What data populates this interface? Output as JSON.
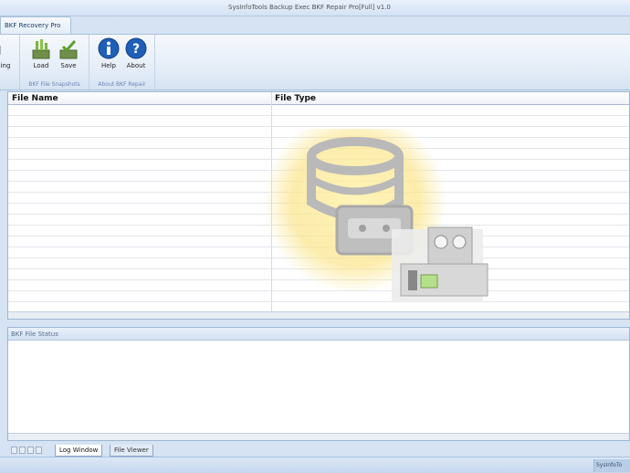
{
  "window": {
    "title": "SysInfoTools Backup Exec BKF Repair Pro[Full] v1.0"
  },
  "ribbon": {
    "tab_label": "BKF Recovery Pro",
    "partial_button_label": "ing",
    "groups": [
      {
        "label": "BKF File Snapshots",
        "buttons": [
          {
            "label": "Load",
            "icon": "load-icon"
          },
          {
            "label": "Save",
            "icon": "save-icon"
          }
        ]
      },
      {
        "label": "About BKF Repair",
        "buttons": [
          {
            "label": "Help",
            "icon": "help-icon"
          },
          {
            "label": "About",
            "icon": "about-icon"
          }
        ]
      }
    ]
  },
  "grid": {
    "columns": [
      "File Name",
      "File Type"
    ]
  },
  "status_panel": {
    "title": "BKF File Status"
  },
  "bottom_tabs": [
    "Log Window",
    "File Viewer"
  ],
  "statusbar": {
    "right_text": "SysInfoTo"
  },
  "colors": {
    "accent": "#d5e3f3",
    "help_icon": "#1f5fb8",
    "load_icon": "#7cb342"
  }
}
